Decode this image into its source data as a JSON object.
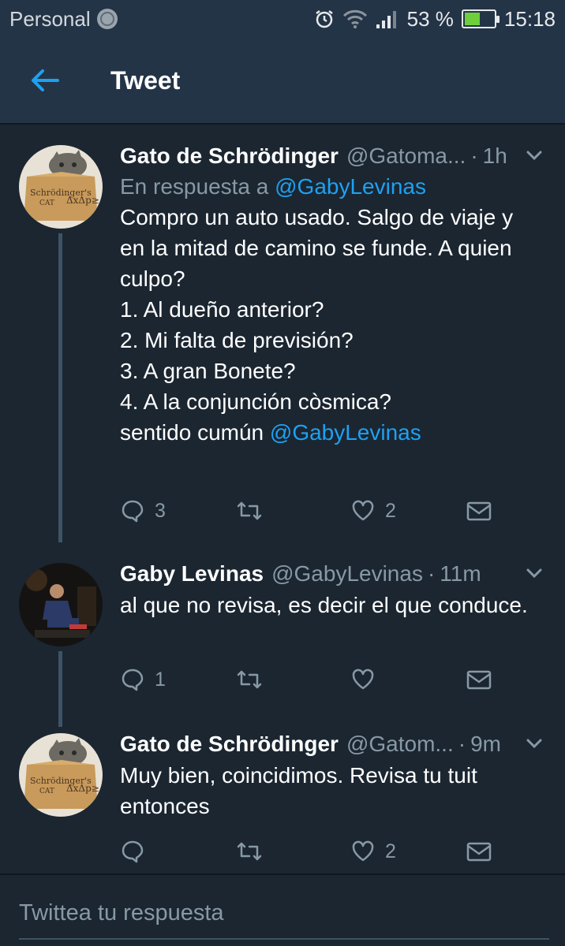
{
  "status_bar": {
    "carrier": "Personal",
    "battery_percent": "53 %",
    "battery_level": 0.53,
    "time": "15:18"
  },
  "header": {
    "title": "Tweet"
  },
  "tweets": [
    {
      "name": "Gato de  Schrödinger",
      "handle": "@Gatoma...",
      "time": "1h",
      "reply_prefix": "En respuesta a",
      "reply_to": "@GabyLevinas",
      "text": "Compro un auto usado. Salgo de viaje y\nen la mitad de camino se funde. A quien\nculpo?\n1. Al dueño anterior?\n2. Mi falta de previsión?\n3. A gran Bonete?\n4. A la conjunción còsmica?\n",
      "text_end": "sentido cumún",
      "text_mention": "@GabyLevinas",
      "replies": "3",
      "retweets": "",
      "likes": "2"
    },
    {
      "name": "Gaby Levinas",
      "handle": "@GabyLevinas",
      "time": "11m",
      "text": "al que no revisa, es decir el que conduce.",
      "replies": "1",
      "retweets": "",
      "likes": ""
    },
    {
      "name": "Gato de  Schrödinger",
      "handle": "@Gatom...",
      "time": "9m",
      "text": "Muy bien, coincidimos. Revisa tu tuit\nentonces",
      "replies": "",
      "retweets": "",
      "likes": "2"
    }
  ],
  "composer": {
    "placeholder": "Twittea tu respuesta"
  },
  "colors": {
    "background": "#1b2631",
    "header": "#243447",
    "accent": "#1da1f2",
    "secondary_text": "#8899a6"
  }
}
